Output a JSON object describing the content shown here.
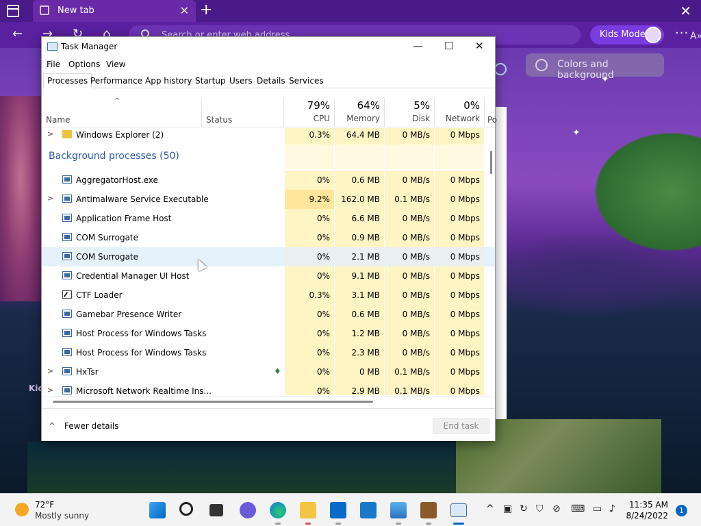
{
  "browser": {
    "tab_title": "New tab",
    "address_placeholder": "Search or enter web address",
    "kids_mode_label": "Kids Mode",
    "menu_glyph": "···",
    "tab_close_glyph": "✕",
    "new_tab_glyph": "+",
    "window_close_glyph": "✕"
  },
  "page": {
    "colors_background_label": "Colors and background",
    "kids_partial_text": "Kic"
  },
  "task_manager": {
    "title": "Task Manager",
    "controls": {
      "minimize": "—",
      "maximize": "☐",
      "close": "✕"
    },
    "menu": [
      "File",
      "Options",
      "View"
    ],
    "tabs": [
      "Processes",
      "Performance",
      "App history",
      "Startup",
      "Users",
      "Details",
      "Services"
    ],
    "active_tab": "Processes",
    "columns": {
      "name": "Name",
      "status": "Status",
      "cpu": {
        "label": "CPU",
        "pct": "79%"
      },
      "memory": {
        "label": "Memory",
        "pct": "64%"
      },
      "disk": {
        "label": "Disk",
        "pct": "5%"
      },
      "network": {
        "label": "Network",
        "pct": "0%"
      },
      "power_partial": "Po"
    },
    "top_row": {
      "name": "Windows Explorer (2)",
      "cpu": "0.3%",
      "memory": "64.4 MB",
      "disk": "0 MB/s",
      "network": "0 Mbps"
    },
    "group_label": "Background processes (50)",
    "rows": [
      {
        "name": "AggregatorHost.exe",
        "expand": false,
        "cpu": "0%",
        "memory": "0.6 MB",
        "disk": "0 MB/s",
        "network": "0 Mbps"
      },
      {
        "name": "Antimalware Service Executable",
        "expand": true,
        "cpu": "9.2%",
        "memory": "162.0 MB",
        "disk": "0.1 MB/s",
        "network": "0 Mbps"
      },
      {
        "name": "Application Frame Host",
        "expand": false,
        "cpu": "0%",
        "memory": "6.6 MB",
        "disk": "0 MB/s",
        "network": "0 Mbps"
      },
      {
        "name": "COM Surrogate",
        "expand": false,
        "cpu": "0%",
        "memory": "0.9 MB",
        "disk": "0 MB/s",
        "network": "0 Mbps"
      },
      {
        "name": "COM Surrogate",
        "expand": false,
        "cpu": "0%",
        "memory": "2.1 MB",
        "disk": "0 MB/s",
        "network": "0 Mbps"
      },
      {
        "name": "Credential Manager UI Host",
        "expand": false,
        "cpu": "0%",
        "memory": "9.1 MB",
        "disk": "0 MB/s",
        "network": "0 Mbps"
      },
      {
        "name": "CTF Loader",
        "expand": false,
        "cpu": "0.3%",
        "memory": "3.1 MB",
        "disk": "0 MB/s",
        "network": "0 Mbps"
      },
      {
        "name": "Gamebar Presence Writer",
        "expand": false,
        "cpu": "0%",
        "memory": "0.6 MB",
        "disk": "0 MB/s",
        "network": "0 Mbps"
      },
      {
        "name": "Host Process for Windows Tasks",
        "expand": false,
        "cpu": "0%",
        "memory": "1.2 MB",
        "disk": "0 MB/s",
        "network": "0 Mbps"
      },
      {
        "name": "Host Process for Windows Tasks",
        "expand": false,
        "cpu": "0%",
        "memory": "2.3 MB",
        "disk": "0 MB/s",
        "network": "0 Mbps"
      },
      {
        "name": "HxTsr",
        "expand": true,
        "cpu": "0%",
        "memory": "0 MB",
        "disk": "0.1 MB/s",
        "network": "0 Mbps"
      },
      {
        "name": "Microsoft Network Realtime Ins...",
        "expand": true,
        "cpu": "0%",
        "memory": "2.9 MB",
        "disk": "0.1 MB/s",
        "network": "0 Mbps"
      }
    ],
    "footer": {
      "fewer_details": "Fewer details",
      "end_task": "End task"
    }
  },
  "taskbar": {
    "weather_temp": "72°F",
    "weather_desc": "Mostly sunny",
    "time": "11:35 AM",
    "date": "8/24/2022",
    "notification_count": "1"
  }
}
